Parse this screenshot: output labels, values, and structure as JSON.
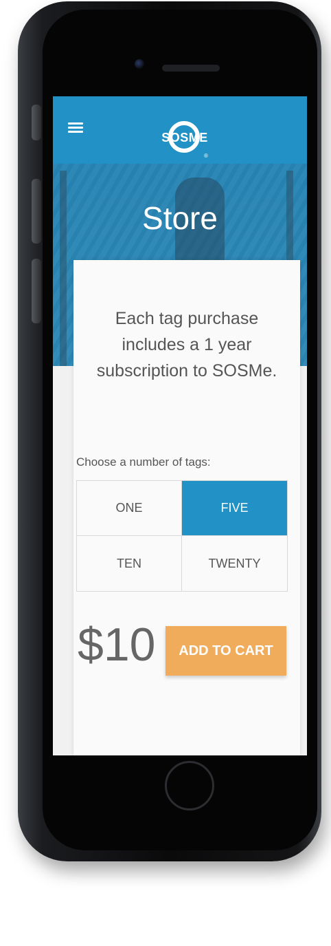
{
  "header": {
    "logo_text": "SOSME",
    "logo_reg": "®"
  },
  "hero": {
    "title": "Store"
  },
  "card": {
    "intro": "Each tag purchase includes a 1 year subscription to SOSMe.",
    "choose_label": "Choose a number of tags:",
    "options": [
      {
        "label": "ONE",
        "selected": false
      },
      {
        "label": "FIVE",
        "selected": true
      },
      {
        "label": "TEN",
        "selected": false
      },
      {
        "label": "TWENTY",
        "selected": false
      }
    ],
    "price": "$10",
    "add_to_cart_label": "ADD TO CART"
  },
  "colors": {
    "brand_blue": "#2292c6",
    "cta_orange": "#f0ac5b"
  },
  "icons": [
    "menu-icon",
    "logo"
  ]
}
